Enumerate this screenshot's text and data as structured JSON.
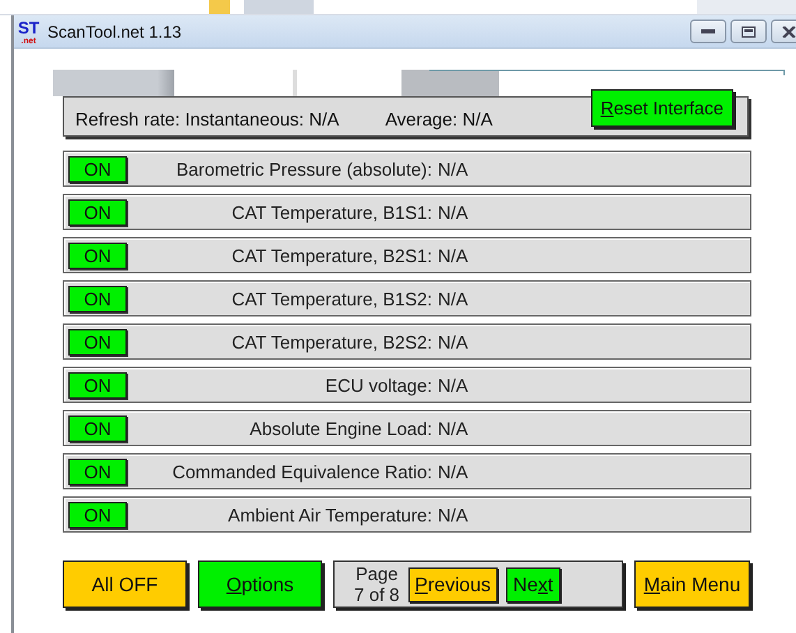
{
  "window": {
    "title": "ScanTool.net 1.13",
    "logo": {
      "main": "ST",
      "sub": ".net"
    }
  },
  "status_panel": {
    "refresh_label": "Refresh rate: Instantaneous: N/A",
    "average_label": "Average: N/A",
    "reset_button": {
      "label": [
        {
          "text": "R",
          "underline": true
        },
        {
          "text": "eset Interface",
          "underline": false
        }
      ]
    }
  },
  "sensors": [
    {
      "toggle": "ON",
      "on": true,
      "name": "Barometric Pressure (absolute):",
      "value": "N/A"
    },
    {
      "toggle": "ON",
      "on": true,
      "name": "CAT Temperature, B1S1:",
      "value": "N/A"
    },
    {
      "toggle": "ON",
      "on": true,
      "name": "CAT Temperature, B2S1:",
      "value": "N/A"
    },
    {
      "toggle": "ON",
      "on": true,
      "name": "CAT Temperature, B1S2:",
      "value": "N/A"
    },
    {
      "toggle": "ON",
      "on": true,
      "name": "CAT Temperature, B2S2:",
      "value": "N/A"
    },
    {
      "toggle": "ON",
      "on": true,
      "name": "ECU voltage:",
      "value": "N/A"
    },
    {
      "toggle": "ON",
      "on": true,
      "name": "Absolute Engine Load:",
      "value": "N/A"
    },
    {
      "toggle": "ON",
      "on": true,
      "name": "Commanded Equivalence Ratio:",
      "value": "N/A"
    },
    {
      "toggle": "ON",
      "on": true,
      "name": "Ambient Air Temperature:",
      "value": "N/A"
    }
  ],
  "footer": {
    "all_off": {
      "label": [
        {
          "text": "All OFF",
          "underline": false
        }
      ]
    },
    "options": {
      "label": [
        {
          "text": "O",
          "underline": true
        },
        {
          "text": "ptions",
          "underline": false
        }
      ]
    },
    "page": {
      "label": "Page",
      "position": "7 of 8"
    },
    "previous": {
      "label": [
        {
          "text": "P",
          "underline": true
        },
        {
          "text": "revious",
          "underline": false
        }
      ]
    },
    "next": {
      "label": [
        {
          "text": "Ne",
          "underline": false
        },
        {
          "text": "x",
          "underline": true
        },
        {
          "text": "t",
          "underline": false
        }
      ]
    },
    "main_menu": {
      "label": [
        {
          "text": "M",
          "underline": true
        },
        {
          "text": "ain Menu",
          "underline": false
        }
      ]
    }
  }
}
